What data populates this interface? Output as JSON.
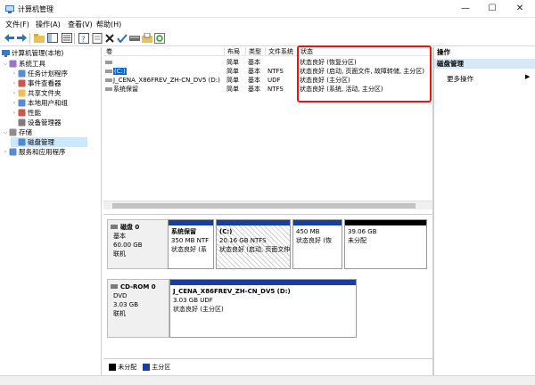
{
  "window": {
    "title": "计算机管理",
    "min": "—",
    "max": "☐",
    "close": "✕"
  },
  "menu": [
    "文件(F)",
    "操作(A)",
    "查看(V)",
    "帮助(H)"
  ],
  "tree": {
    "root": "计算机管理(本地)",
    "items": [
      {
        "label": "系统工具",
        "level": 1,
        "exp": "⌵"
      },
      {
        "label": "任务计划程序",
        "level": 2,
        "exp": "›"
      },
      {
        "label": "事件查看器",
        "level": 2,
        "exp": "›"
      },
      {
        "label": "共享文件夹",
        "level": 2,
        "exp": "›"
      },
      {
        "label": "本地用户和组",
        "level": 2,
        "exp": "›"
      },
      {
        "label": "性能",
        "level": 2,
        "exp": "›"
      },
      {
        "label": "设备管理器",
        "level": 2,
        "exp": ""
      },
      {
        "label": "存储",
        "level": 1,
        "exp": "⌵"
      },
      {
        "label": "磁盘管理",
        "level": 2,
        "exp": "",
        "selected": true
      },
      {
        "label": "服务和应用程序",
        "level": 1,
        "exp": "›"
      }
    ]
  },
  "columns": [
    "卷",
    "布局",
    "类型",
    "文件系统",
    "状态"
  ],
  "volumes": [
    {
      "name": "",
      "layout": "简单",
      "type": "基本",
      "fs": "",
      "status": "状态良好 (恢复分区)"
    },
    {
      "name": "(C:)",
      "layout": "简单",
      "type": "基本",
      "fs": "NTFS",
      "status": "状态良好 (启动, 页面文件, 故障转储, 主分区)"
    },
    {
      "name": "J_CENA_X86FREV_ZH-CN_DV5 (D:)",
      "layout": "简单",
      "type": "基本",
      "fs": "UDF",
      "status": "状态良好 (主分区)"
    },
    {
      "name": "系统保留",
      "layout": "简单",
      "type": "基本",
      "fs": "NTFS",
      "status": "状态良好 (系统, 活动, 主分区)"
    }
  ],
  "disks": [
    {
      "title": "磁盘 0",
      "kind": "基本",
      "size": "60.00 GB",
      "state": "联机",
      "partitions": [
        {
          "name": "系统保留",
          "size": "350 MB NTF",
          "status": "状态良好 (系",
          "bar": "#1a3e9e"
        },
        {
          "name": "(C:)",
          "size": "20.16 GB NTFS",
          "status": "状态良好 (启动, 页面文仲",
          "bar": "#1a3e9e",
          "hatched": true
        },
        {
          "name": "",
          "size": "450 MB",
          "status": "状态良好 (恢",
          "bar": "#1a3e9e"
        },
        {
          "name": "",
          "size": "39.06 GB",
          "status": "未分配",
          "bar": "#000000"
        }
      ]
    },
    {
      "title": "CD-ROM 0",
      "kind": "DVD",
      "size": "3.03 GB",
      "state": "联机",
      "partitions": [
        {
          "name": "J_CENA_X86FREV_ZH-CN_DV5 (D:)",
          "size": "3.03 GB UDF",
          "status": "状态良好 (主分区)",
          "bar": "#1a3e9e"
        }
      ]
    }
  ],
  "legend": [
    {
      "label": "未分配",
      "color": "#000000"
    },
    {
      "label": "主分区",
      "color": "#1a3e9e"
    }
  ],
  "actions": {
    "header": "操作",
    "section": "磁盘管理",
    "more": "更多操作",
    "more_arrow": "▶"
  }
}
